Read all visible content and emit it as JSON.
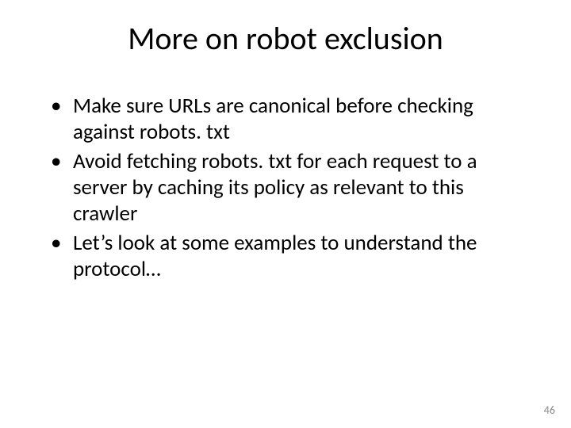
{
  "title": "More on robot exclusion",
  "bullets": [
    "Make sure URLs are canonical before checking against robots. txt",
    "Avoid fetching robots. txt for each request to a server by caching its policy as relevant to this crawler",
    "Let’s look at some examples to understand the protocol…"
  ],
  "page_number": "46"
}
